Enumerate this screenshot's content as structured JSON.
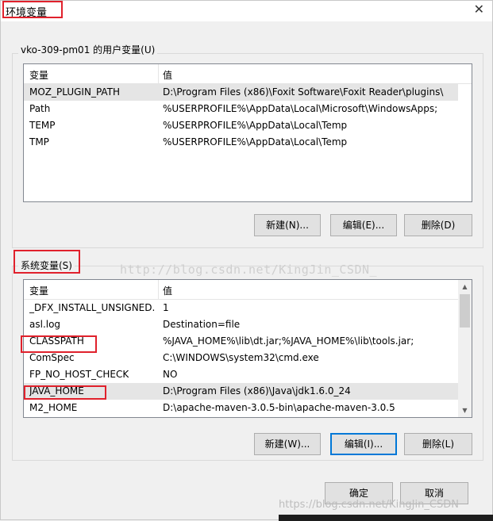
{
  "window": {
    "title": "环境变量",
    "close_glyph": "✕"
  },
  "user_vars": {
    "group_label": "vko-309-pm01 的用户变量(U)",
    "col_name": "变量",
    "col_value": "值",
    "rows": [
      {
        "name": "MOZ_PLUGIN_PATH",
        "value": "D:\\Program Files (x86)\\Foxit Software\\Foxit Reader\\plugins\\"
      },
      {
        "name": "Path",
        "value": "%USERPROFILE%\\AppData\\Local\\Microsoft\\WindowsApps;"
      },
      {
        "name": "TEMP",
        "value": "%USERPROFILE%\\AppData\\Local\\Temp"
      },
      {
        "name": "TMP",
        "value": "%USERPROFILE%\\AppData\\Local\\Temp"
      }
    ],
    "buttons": {
      "new": "新建(N)...",
      "edit": "编辑(E)...",
      "delete": "删除(D)"
    }
  },
  "system_vars": {
    "group_label": "系统变量(S)",
    "col_name": "变量",
    "col_value": "值",
    "rows": [
      {
        "name": "_DFX_INSTALL_UNSIGNED...",
        "value": "1"
      },
      {
        "name": "asl.log",
        "value": "Destination=file"
      },
      {
        "name": "CLASSPATH",
        "value": "%JAVA_HOME%\\lib\\dt.jar;%JAVA_HOME%\\lib\\tools.jar;"
      },
      {
        "name": "ComSpec",
        "value": "C:\\WINDOWS\\system32\\cmd.exe"
      },
      {
        "name": "FP_NO_HOST_CHECK",
        "value": "NO"
      },
      {
        "name": "JAVA_HOME",
        "value": "D:\\Program Files (x86)\\Java\\jdk1.6.0_24"
      },
      {
        "name": "M2_HOME",
        "value": "D:\\apache-maven-3.0.5-bin\\apache-maven-3.0.5"
      }
    ],
    "buttons": {
      "new": "新建(W)...",
      "edit": "编辑(I)...",
      "delete": "删除(L)"
    }
  },
  "footer": {
    "ok": "确定",
    "cancel": "取消"
  },
  "watermarks": {
    "main": "http://blog.csdn.net/KingJin_CSDN_",
    "corner": "https://blog.csdn.net/KingJin_CSDN"
  },
  "colors": {
    "highlight_box": "#e0212c",
    "focus_border": "#0078d7",
    "selected_row": "#e5e5e5"
  }
}
